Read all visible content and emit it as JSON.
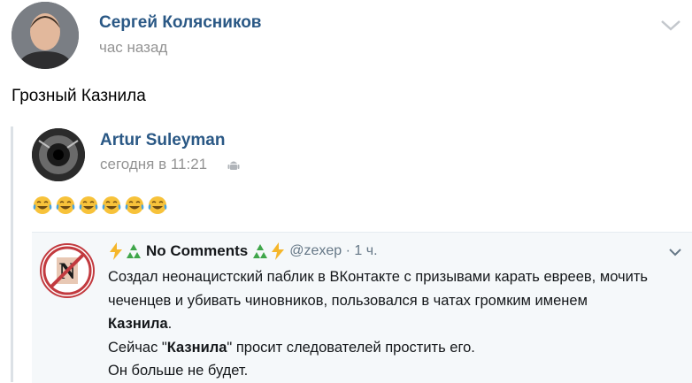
{
  "post": {
    "author": "Сергей Колясников",
    "time": "час назад",
    "text": "Грозный Казнила"
  },
  "repost": {
    "author": "Artur Suleyman",
    "time": "сегодня в 11:21",
    "emojis": [
      "😂",
      "😂",
      "😂",
      "😂",
      "😂",
      "😂"
    ]
  },
  "tweet": {
    "name": "No Comments",
    "handle": "@zexep · 1 ч.",
    "line1": "Создал неонацистский паблик в ВКонтакте с призывами карать евреев, мочить",
    "line2": "чеченцев и убивать чиновников, пользовался в чатах громким именем",
    "line3_bold": "Казнила",
    "line3_end": ".",
    "line4_start": "Сейчас \"",
    "line4_bold": "Казнила",
    "line4_end": "\" просит следователей простить его.",
    "line5": "Он больше не будет."
  },
  "colors": {
    "link": "#2a5885",
    "muted": "#939393",
    "tweet_bg": "#f5f8fa"
  }
}
